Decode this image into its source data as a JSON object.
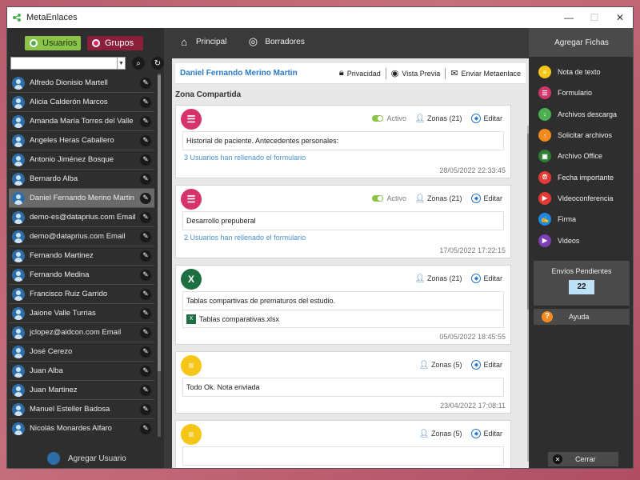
{
  "window": {
    "title": "MetaEnlaces",
    "controls": [
      "—",
      "☐",
      "✕"
    ]
  },
  "left": {
    "tabs": {
      "users": "Usuarios",
      "groups": "Grupos"
    },
    "search": {
      "value": "",
      "placeholder": ""
    },
    "users": [
      "Alfredo Dionisio Martell",
      "Alicia Calderón Marcos",
      "Amanda María Torres del Valle",
      "Angeles Heras Caballero",
      "Antonio Jiménez Bosque",
      "Bernardo Alba",
      "Daniel Fernando Merino Martin",
      "demo-es@dataprius.com Email",
      "demo@dataprius.com Email",
      "Fernando Martinez",
      "Fernando Medina",
      "Francisco Ruiz Garrido",
      "Jaione Valle Turrias",
      "jclopez@aidcon.com Email",
      "José Cerezo",
      "Juan Alba",
      "Juan Martinez",
      "Manuel Esteller Badosa",
      "Nicolás Monardes Alfaro"
    ],
    "selected_index": 6,
    "add_user": "Agregar Usuario"
  },
  "nav": {
    "home": "Principal",
    "drafts": "Borradores"
  },
  "header": {
    "user": "Daniel Fernando Merino Martin",
    "privacy": "Privacidad",
    "preview": "Vista Previa",
    "send": "Enviar Metaenlace"
  },
  "zone_title": "Zona Compartida",
  "cards": [
    {
      "type": "form",
      "color": "#d6336c",
      "active": "Activo",
      "zones": "Zonas (21)",
      "edit": "Editar",
      "text": "Historial de paciente. Antecedentes personales:",
      "link": "3 Usuarios han rellenado el formulario",
      "date": "28/05/2022 22:33:45"
    },
    {
      "type": "form",
      "color": "#d6336c",
      "active": "Activo",
      "zones": "Zonas (21)",
      "edit": "Editar",
      "text": "Desarrollo prepuberal",
      "link": "2 Usuarios han rellenado el formulario",
      "date": "17/05/2022 17:22:15"
    },
    {
      "type": "office",
      "color": "#1d6f42",
      "zones": "Zonas (21)",
      "edit": "Editar",
      "text": "Tablas compartivas de prematuros del estudio.",
      "file": "Tablas comparativas.xlsx",
      "date": "05/05/2022 18:45:55"
    },
    {
      "type": "note",
      "color": "#f5c518",
      "zones": "Zonas (5)",
      "edit": "Editar",
      "text": "Todo Ok. Nota enviada",
      "date": "23/04/2022 17:08:11"
    },
    {
      "type": "note",
      "color": "#f5c518",
      "zones": "Zonas (5)",
      "edit": "Editar",
      "text": "",
      "date": ""
    }
  ],
  "right": {
    "title": "Agregar Fichas",
    "items": [
      {
        "label": "Nota de texto",
        "icon": "note-icon",
        "color": "#f5c518"
      },
      {
        "label": "Formulario",
        "icon": "form-icon",
        "color": "#d6336c"
      },
      {
        "label": "Archivos descarga",
        "icon": "download-icon",
        "color": "#4caf50"
      },
      {
        "label": "Solicitar archivos",
        "icon": "upload-request-icon",
        "color": "#f28a1e"
      },
      {
        "label": "Archivo Office",
        "icon": "office-icon",
        "color": "#2e7d32"
      },
      {
        "label": "Fecha importante",
        "icon": "alarm-icon",
        "color": "#e53935"
      },
      {
        "label": "Videoconferencia",
        "icon": "video-call-icon",
        "color": "#e53935"
      },
      {
        "label": "Firma",
        "icon": "signature-icon",
        "color": "#1e88e5"
      },
      {
        "label": "Videos",
        "icon": "video-icon",
        "color": "#7e3fb5"
      }
    ],
    "pending_label": "Envíos Pendientes",
    "pending_count": "22",
    "help": "Ayuda",
    "close": "Cerrar"
  }
}
